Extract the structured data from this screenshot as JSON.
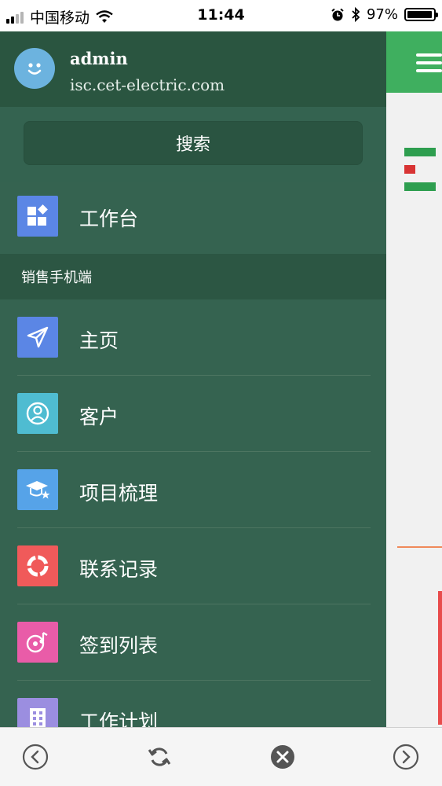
{
  "status_bar": {
    "carrier": "中国移动",
    "time": "11:44",
    "battery": "97%",
    "battery_level": 0.97
  },
  "drawer": {
    "user": {
      "name": "admin",
      "domain": "isc.cet-electric.com"
    },
    "search_label": "搜索",
    "workbench_label": "工作台",
    "section_title": "销售手机端",
    "items": [
      {
        "label": "主页",
        "icon": "paper-plane-icon",
        "color": "#5b86e5"
      },
      {
        "label": "客户",
        "icon": "user-circle-icon",
        "color": "#4fbcd1"
      },
      {
        "label": "项目梳理",
        "icon": "graduation-cap-icon",
        "color": "#56a3e8"
      },
      {
        "label": "联系记录",
        "icon": "refresh-ring-icon",
        "color": "#f05a5a"
      },
      {
        "label": "签到列表",
        "icon": "music-disc-icon",
        "color": "#e95ca8"
      },
      {
        "label": "工作计划",
        "icon": "building-icon",
        "color": "#9b8ee0"
      }
    ]
  },
  "colors": {
    "drawer_bg": "#2f5c46",
    "header_bg": "#3faf5f",
    "workbench_icon": "#5b86e5"
  }
}
